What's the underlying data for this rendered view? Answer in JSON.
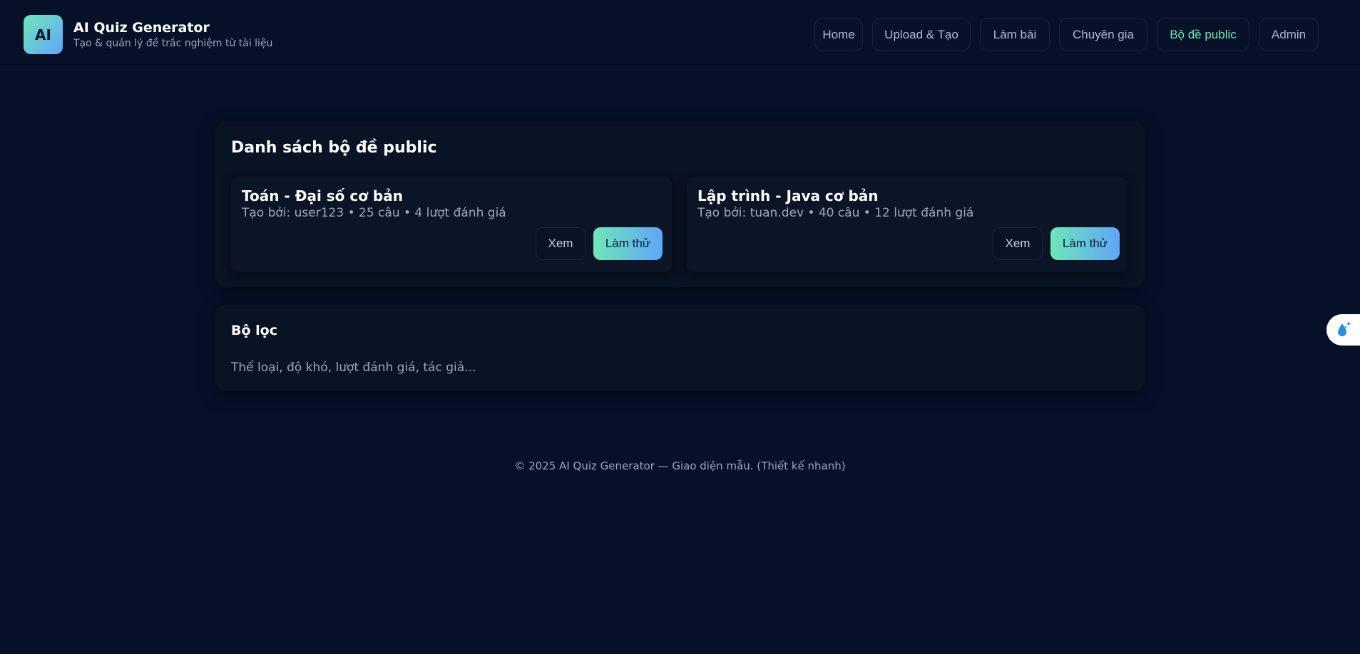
{
  "brand": {
    "logo_text": "AI",
    "title": "AI Quiz Generator",
    "subtitle": "Tạo & quản lý đề trắc nghiệm từ tài liệu"
  },
  "nav": {
    "items": [
      {
        "label": "Home"
      },
      {
        "label": "Upload & Tạo"
      },
      {
        "label": "Làm bài"
      },
      {
        "label": "Chuyên gia"
      },
      {
        "label": "Bộ đề public",
        "active": true
      },
      {
        "label": "Admin"
      }
    ]
  },
  "public_sets": {
    "title": "Danh sách bộ đề public",
    "quizzes": [
      {
        "title": "Toán - Đại số cơ bản",
        "meta": "Tạo bởi: user123 • 25 câu • 4 lượt đánh giá",
        "view_label": "Xem",
        "try_label": "Làm thử"
      },
      {
        "title": "Lập trình - Java cơ bản",
        "meta": "Tạo bởi: tuan.dev • 40 câu • 12 lượt đánh giá",
        "view_label": "Xem",
        "try_label": "Làm thử"
      }
    ]
  },
  "filter": {
    "title": "Bộ lọc",
    "description": "Thể loại, độ khó, lượt đánh giá, tác giả..."
  },
  "footer": {
    "text": "© 2025 AI Quiz Generator — Giao diện mẫu. (Thiết kế nhanh)"
  },
  "floating_button": {
    "icon": "sparkle-drop-icon"
  },
  "colors": {
    "background": "#061027",
    "accent_green": "#6ee7b7",
    "accent_blue": "#60a5fa"
  }
}
